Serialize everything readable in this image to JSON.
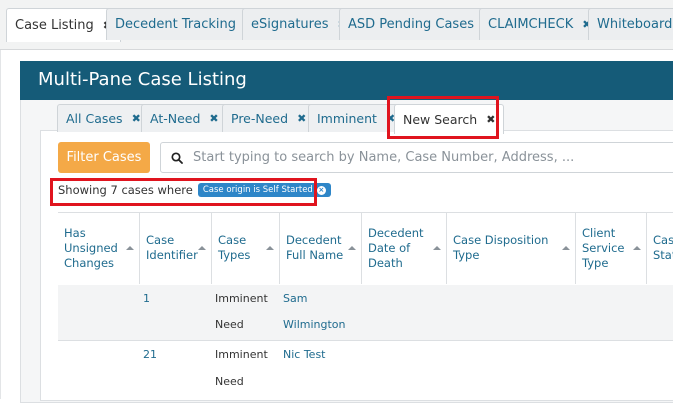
{
  "top_tabs": [
    {
      "label": "Case Listing",
      "active": true
    },
    {
      "label": "Decedent Tracking"
    },
    {
      "label": "eSignatures"
    },
    {
      "label": "ASD Pending Cases"
    },
    {
      "label": "CLAIMCHECK"
    },
    {
      "label": "Whiteboard"
    }
  ],
  "panel": {
    "title": "Multi-Pane Case Listing"
  },
  "sub_tabs": [
    {
      "label": "All Cases"
    },
    {
      "label": "At-Need"
    },
    {
      "label": "Pre-Need"
    },
    {
      "label": "Imminent"
    },
    {
      "label": "New Search",
      "active": true
    }
  ],
  "close_glyph": "✖",
  "filter_button": "Filter Cases",
  "search": {
    "placeholder": "Start typing to search by Name, Case Number, Address, ..."
  },
  "summary": {
    "prefix": "Showing 7 cases where",
    "chip": "Case origin is Self Started",
    "chip_close": "×"
  },
  "table": {
    "columns": [
      "Has Unsigned Changes",
      "Case Identifier",
      "Case Types",
      "Decedent Full Name",
      "Decedent Date of Death",
      "Case Disposition Type",
      "Client Service Type",
      "Case Stat"
    ],
    "rows": [
      {
        "case_identifier": "1",
        "case_types": [
          "Imminent",
          "Need"
        ],
        "decedent_name": [
          "Sam",
          "Wilmington"
        ]
      },
      {
        "case_identifier": "21",
        "case_types": [
          "Imminent",
          "Need"
        ],
        "decedent_name": [
          "Nic Test"
        ]
      }
    ]
  },
  "colors": {
    "header": "#155b78",
    "accent": "#f4a947",
    "link": "#1f6b8e",
    "highlight": "#e0141e",
    "chip": "#2e86c8"
  },
  "icons": {
    "close": "close-icon",
    "search": "search-icon",
    "sort": "sort-icon"
  }
}
